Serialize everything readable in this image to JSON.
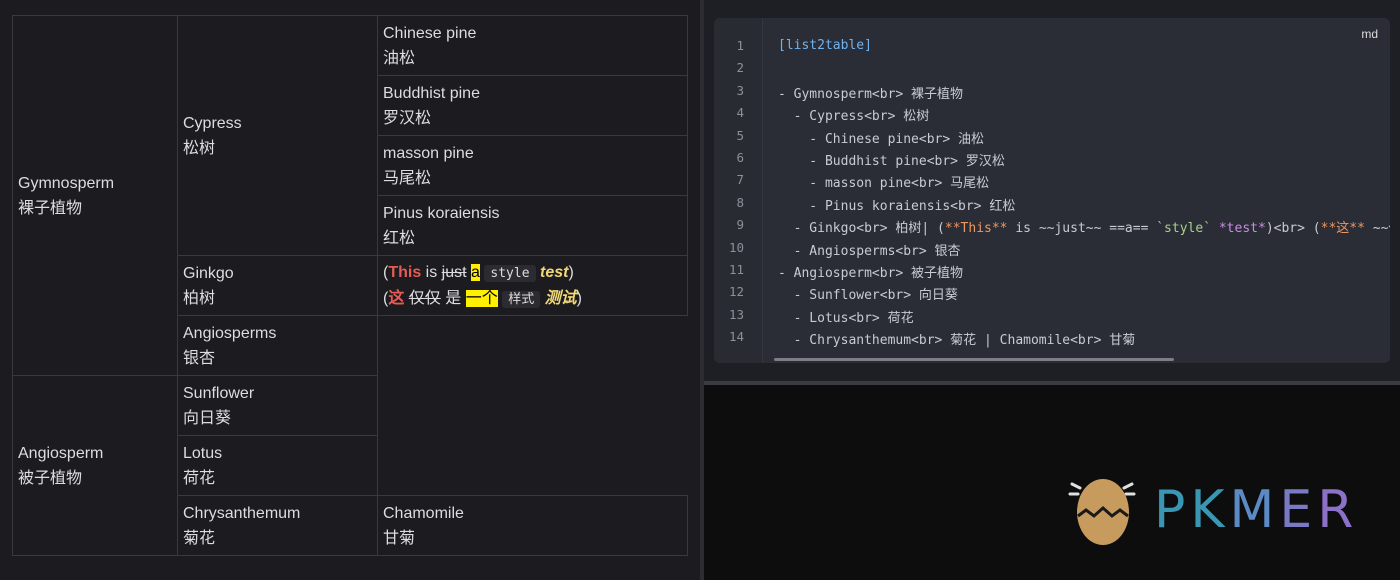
{
  "table": {
    "gymnosperm": {
      "en": "Gymnosperm",
      "zh": "裸子植物"
    },
    "cypress": {
      "en": "Cypress",
      "zh": "松树"
    },
    "chinese_pine": {
      "en": "Chinese pine",
      "zh": "油松"
    },
    "buddhist_pine": {
      "en": "Buddhist pine",
      "zh": "罗汉松"
    },
    "masson_pine": {
      "en": "masson pine",
      "zh": "马尾松"
    },
    "pinus_koraiensis": {
      "en": "Pinus koraiensis",
      "zh": "红松"
    },
    "ginkgo": {
      "en": "Ginkgo",
      "zh": "柏树"
    },
    "ginkgo_note_en": {
      "open": "(",
      "bold": "This",
      "is": " is ",
      "strike": "just",
      "space": " ",
      "hl": "a",
      "code": "style",
      "ital": "test",
      "close": ")"
    },
    "ginkgo_note_zh": {
      "open": "(",
      "bold": "这",
      "strike": "仅仅",
      "is": " 是 ",
      "hl": "一个",
      "code": "样式",
      "ital": "测试",
      "close": ")"
    },
    "angiosperms": {
      "en": "Angiosperms",
      "zh": "银杏"
    },
    "angiosperm": {
      "en": "Angiosperm",
      "zh": "被子植物"
    },
    "sunflower": {
      "en": "Sunflower",
      "zh": "向日葵"
    },
    "lotus": {
      "en": "Lotus",
      "zh": "荷花"
    },
    "chrysanthemum": {
      "en": "Chrysanthemum",
      "zh": "菊花"
    },
    "chamomile": {
      "en": "Chamomile",
      "zh": "甘菊"
    }
  },
  "editor": {
    "lang_label": "md",
    "line_numbers": [
      "1",
      "2",
      "3",
      "4",
      "5",
      "6",
      "7",
      "8",
      "9",
      "10",
      "11",
      "12",
      "13",
      "14"
    ],
    "lines": [
      [
        {
          "t": "[list2table]",
          "c": "blue"
        }
      ],
      [],
      [
        {
          "t": "- Gymnosperm<br> 裸子植物",
          "c": "dim"
        }
      ],
      [
        {
          "t": "  - Cypress<br> 松树",
          "c": "dim"
        }
      ],
      [
        {
          "t": "    - Chinese pine<br> 油松",
          "c": "dim"
        }
      ],
      [
        {
          "t": "    - Buddhist pine<br> 罗汉松",
          "c": "dim"
        }
      ],
      [
        {
          "t": "    - masson pine<br> 马尾松",
          "c": "dim"
        }
      ],
      [
        {
          "t": "    - Pinus koraiensis<br> 红松",
          "c": "dim"
        }
      ],
      [
        {
          "t": "  - Ginkgo<br> 柏树| (",
          "c": "dim"
        },
        {
          "t": "**This**",
          "c": "orange"
        },
        {
          "t": " is ~~just~~ ==a== ",
          "c": "dim"
        },
        {
          "t": "`style`",
          "c": "green"
        },
        {
          "t": " ",
          "c": "dim"
        },
        {
          "t": "*test*",
          "c": "purple"
        },
        {
          "t": ")<br> (",
          "c": "dim"
        },
        {
          "t": "**这**",
          "c": "orange"
        },
        {
          "t": " ~~仅",
          "c": "dim"
        }
      ],
      [
        {
          "t": "  - Angiosperms<br> 银杏",
          "c": "dim"
        }
      ],
      [
        {
          "t": "- Angiosperm<br> 被子植物",
          "c": "dim"
        }
      ],
      [
        {
          "t": "  - Sunflower<br> 向日葵",
          "c": "dim"
        }
      ],
      [
        {
          "t": "  - Lotus<br> 荷花",
          "c": "dim"
        }
      ],
      [
        {
          "t": "  - Chrysanthemum<br> 菊花 | Chamomile<br> 甘菊",
          "c": "dim"
        }
      ]
    ]
  },
  "logo": {
    "text": "PKMER",
    "colors": {
      "p": "#3a97b4",
      "k": "#3a97b4",
      "m": "#5b8ac4",
      "e": "#7a79c4",
      "r": "#8b72c8",
      "egg": "#c79b5e"
    }
  }
}
